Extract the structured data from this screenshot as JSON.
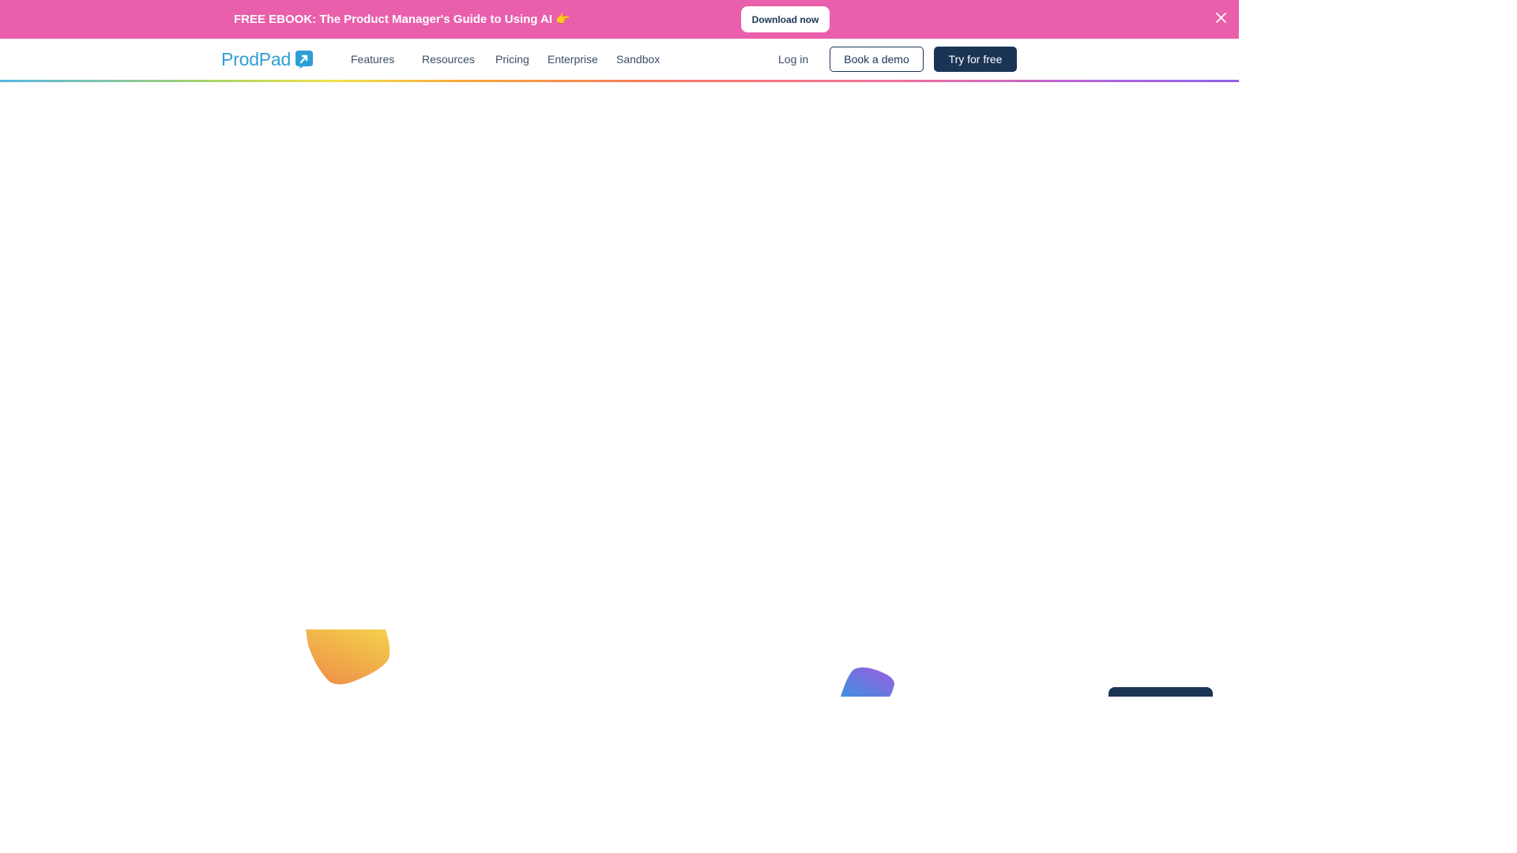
{
  "promo": {
    "text": "FREE EBOOK: The Product Manager's Guide to Using AI",
    "emoji": "👉",
    "button_label": "Download now",
    "close_icon": "close-icon"
  },
  "nav": {
    "logo_text": "ProdPad",
    "logo_icon": "prodpad-logo-icon",
    "links": [
      {
        "label": "Features"
      },
      {
        "label": "Resources"
      },
      {
        "label": "Pricing"
      },
      {
        "label": "Enterprise"
      },
      {
        "label": "Sandbox"
      }
    ],
    "login_label": "Log in",
    "demo_label": "Book a demo",
    "trial_label": "Try for free"
  },
  "colors": {
    "promo_bg": "#e95fac",
    "brand_blue": "#2e9ed6",
    "navy": "#1b3456"
  }
}
